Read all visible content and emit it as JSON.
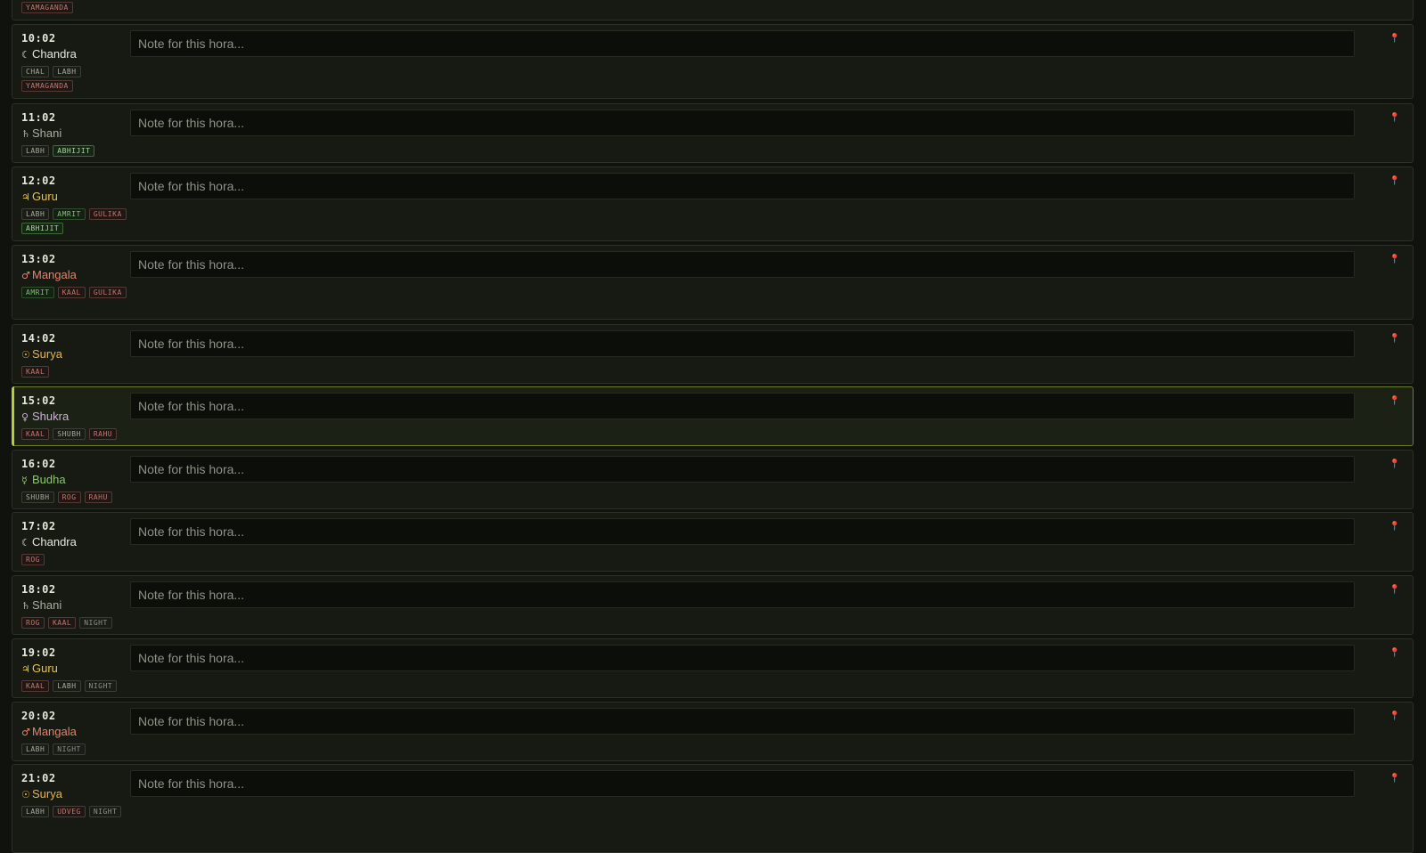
{
  "note_placeholder": "Note for this hora...",
  "pin_icon": "📍",
  "top_fragment": {
    "tags": [
      {
        "label": "YAMAGANDA",
        "kind": "bad"
      }
    ]
  },
  "horas": [
    {
      "time": "10:02",
      "planet": "Chandra",
      "glyph": "☾",
      "color": "#e6e8dc",
      "tags": [
        {
          "label": "CHAL",
          "kind": "neutral"
        },
        {
          "label": "LABH",
          "kind": "neutral"
        },
        {
          "label": "YAMAGANDA",
          "kind": "bad"
        }
      ]
    },
    {
      "time": "11:02",
      "planet": "Shani",
      "glyph": "♄",
      "color": "#a9ad9f",
      "tags": [
        {
          "label": "LABH",
          "kind": "neutral"
        },
        {
          "label": "ABHIJIT",
          "kind": "special"
        }
      ]
    },
    {
      "time": "12:02",
      "planet": "Guru",
      "glyph": "♃",
      "color": "#e8c34a",
      "tags": [
        {
          "label": "LABH",
          "kind": "neutral"
        },
        {
          "label": "AMRIT",
          "kind": "good"
        },
        {
          "label": "GULIKA",
          "kind": "bad"
        },
        {
          "label": "ABHIJIT",
          "kind": "special"
        }
      ]
    },
    {
      "time": "13:02",
      "planet": "Mangala",
      "glyph": "♂",
      "color": "#e0846e",
      "tags": [
        {
          "label": "AMRIT",
          "kind": "good"
        },
        {
          "label": "KAAL",
          "kind": "bad"
        },
        {
          "label": "GULIKA",
          "kind": "bad"
        }
      ]
    },
    {
      "time": "14:02",
      "planet": "Surya",
      "glyph": "☉",
      "color": "#e9b04f",
      "tags": [
        {
          "label": "KAAL",
          "kind": "bad"
        }
      ]
    },
    {
      "time": "15:02",
      "planet": "Shukra",
      "glyph": "♀",
      "color": "#cbb0d8",
      "current": true,
      "tags": [
        {
          "label": "KAAL",
          "kind": "bad"
        },
        {
          "label": "SHUBH",
          "kind": "neutral"
        },
        {
          "label": "RAHU",
          "kind": "bad"
        }
      ]
    },
    {
      "time": "16:02",
      "planet": "Budha",
      "glyph": "☿",
      "color": "#8dc56e",
      "tags": [
        {
          "label": "SHUBH",
          "kind": "neutral"
        },
        {
          "label": "ROG",
          "kind": "bad"
        },
        {
          "label": "RAHU",
          "kind": "bad"
        }
      ]
    },
    {
      "time": "17:02",
      "planet": "Chandra",
      "glyph": "☾",
      "color": "#e6e8dc",
      "tags": [
        {
          "label": "ROG",
          "kind": "bad"
        }
      ]
    },
    {
      "time": "18:02",
      "planet": "Shani",
      "glyph": "♄",
      "color": "#a9ad9f",
      "tags": [
        {
          "label": "ROG",
          "kind": "bad"
        },
        {
          "label": "KAAL",
          "kind": "bad"
        },
        {
          "label": "NIGHT",
          "kind": "night"
        }
      ]
    },
    {
      "time": "19:02",
      "planet": "Guru",
      "glyph": "♃",
      "color": "#e8c34a",
      "tags": [
        {
          "label": "KAAL",
          "kind": "bad"
        },
        {
          "label": "LABH",
          "kind": "neutral"
        },
        {
          "label": "NIGHT",
          "kind": "night"
        }
      ]
    },
    {
      "time": "20:02",
      "planet": "Mangala",
      "glyph": "♂",
      "color": "#e0846e",
      "tags": [
        {
          "label": "LABH",
          "kind": "neutral"
        },
        {
          "label": "NIGHT",
          "kind": "night"
        }
      ]
    },
    {
      "time": "21:02",
      "planet": "Surya",
      "glyph": "☉",
      "color": "#e9b04f",
      "tags": [
        {
          "label": "LABH",
          "kind": "neutral"
        },
        {
          "label": "UDVEG",
          "kind": "bad"
        },
        {
          "label": "NIGHT",
          "kind": "night"
        }
      ]
    }
  ]
}
